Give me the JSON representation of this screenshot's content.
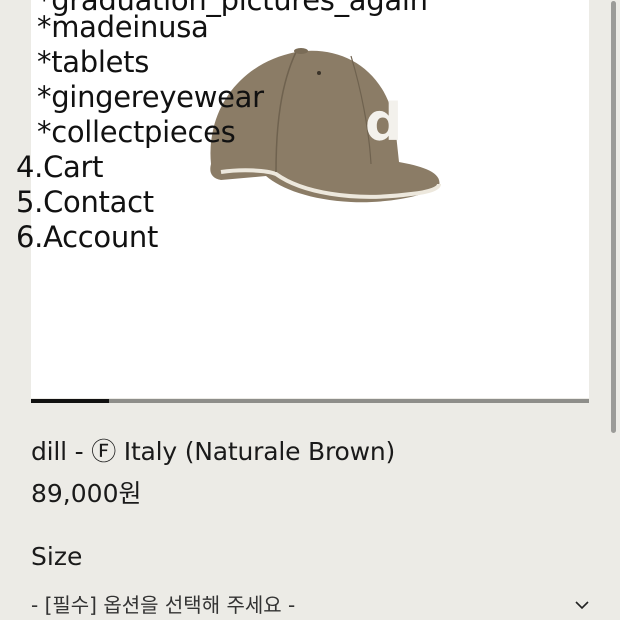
{
  "nav": {
    "partial_item": "*graduation_pictures_again",
    "sub_items": [
      "*madeinusa",
      "*tablets",
      "*gingereyewear",
      "*collectpieces"
    ],
    "main_items": [
      "4.Cart",
      "5.Contact",
      "6.Account"
    ]
  },
  "image": {
    "alt_letter": "d",
    "cap_color": "#8b7c66"
  },
  "gallery": {
    "progress": 0.14
  },
  "product": {
    "name": "dill - Ⓕ Italy (Naturale Brown)",
    "price": "89,000원"
  },
  "options": {
    "size_label": "Size",
    "size_select_value": "- [필수] 옵션을 선택해 주세요 -"
  },
  "icons": {
    "chevron": "chevron-down-icon"
  }
}
